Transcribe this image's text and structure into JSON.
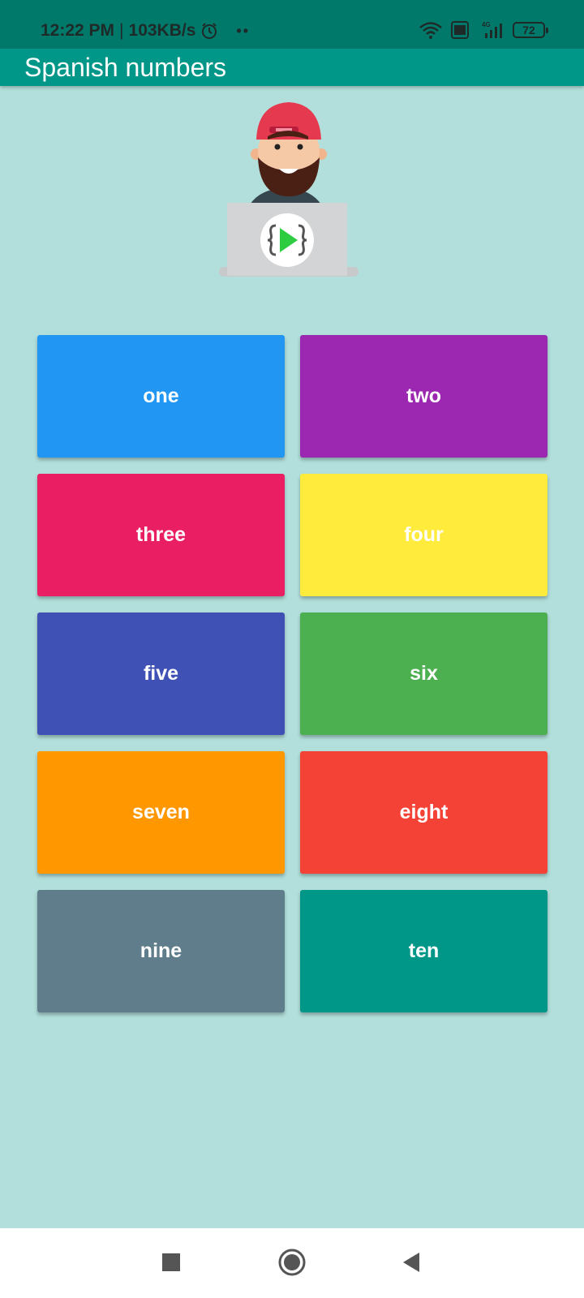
{
  "status_bar": {
    "time": "12:22 PM",
    "separator": "|",
    "speed": "103KB/s",
    "dots": "••",
    "volte": "Vo LTE",
    "network": "4G",
    "battery": "72"
  },
  "app_bar": {
    "title": "Spanish numbers"
  },
  "numbers": [
    {
      "label": "one",
      "color": "#2196f3"
    },
    {
      "label": "two",
      "color": "#9c27b0"
    },
    {
      "label": "three",
      "color": "#e91e63"
    },
    {
      "label": "four",
      "color": "#ffeb3b"
    },
    {
      "label": "five",
      "color": "#3f51b5"
    },
    {
      "label": "six",
      "color": "#4caf50"
    },
    {
      "label": "seven",
      "color": "#ff9800"
    },
    {
      "label": "eight",
      "color": "#f44336"
    },
    {
      "label": "nine",
      "color": "#607d8b"
    },
    {
      "label": "ten",
      "color": "#009688"
    }
  ],
  "colors": {
    "status_bar": "#00796b",
    "app_bar": "#009688",
    "background": "#b2dfdb"
  },
  "nav": {
    "recents_icon": "square-icon",
    "home_icon": "circle-icon",
    "back_icon": "triangle-back-icon"
  }
}
